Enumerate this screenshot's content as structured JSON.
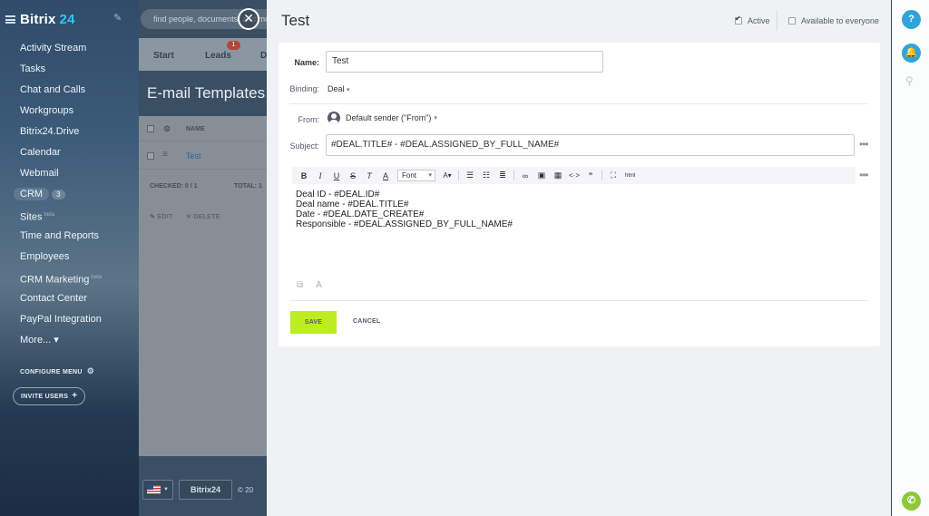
{
  "app": {
    "logo_name": "Bitrix",
    "logo_num": "24",
    "colors": {
      "accent": "#2fc6f6",
      "save": "#bbed21",
      "phone": "#8fc93a"
    }
  },
  "sidebar": {
    "items": [
      {
        "label": "Activity Stream"
      },
      {
        "label": "Tasks"
      },
      {
        "label": "Chat and Calls"
      },
      {
        "label": "Workgroups"
      },
      {
        "label": "Bitrix24.Drive"
      },
      {
        "label": "Calendar"
      },
      {
        "label": "Webmail"
      },
      {
        "label": "CRM",
        "count": "3"
      },
      {
        "label": "Sites",
        "sup": "beta"
      },
      {
        "label": "Time and Reports"
      },
      {
        "label": "Employees"
      },
      {
        "label": "CRM Marketing",
        "sup": "beta"
      },
      {
        "label": "Contact Center"
      },
      {
        "label": "PayPal Integration"
      },
      {
        "label": "More... ▾"
      }
    ],
    "configure_label": "CONFIGURE MENU",
    "invite_label": "INVITE USERS"
  },
  "background": {
    "search_placeholder": "find people, documents, and mo",
    "tabs": [
      "Start",
      "Leads",
      "D"
    ],
    "leads_badge": "1",
    "page_title": "E-mail Templates",
    "grid": {
      "header_name": "NAME",
      "row_name": "Test",
      "checked": "CHECKED: 0 / 1",
      "total": "TOTAL: 1",
      "edit": "EDIT",
      "delete": "DELETE"
    },
    "footer_b24": "Bitrix24",
    "footer_copy": "© 20"
  },
  "slider": {
    "title": "Test",
    "active_label": "Active",
    "active_checked": true,
    "everyone_label": "Available to everyone",
    "everyone_checked": false,
    "form": {
      "name_label": "Name:",
      "name_value": "Test",
      "binding_label": "Binding:",
      "binding_value": "Deal",
      "from_label": "From:",
      "from_value": "Default sender (\"From\")",
      "subject_label": "Subject:",
      "subject_value": "#DEAL.TITLE# -  #DEAL.ASSIGNED_BY_FULL_NAME#"
    },
    "toolbar": {
      "bold": "B",
      "italic": "I",
      "underline": "U",
      "strike": "S",
      "clear": "T",
      "font_color": "A",
      "font": "Font",
      "font_size": "A",
      "html": "html"
    },
    "editor_lines": [
      "Deal ID - #DEAL.ID#",
      "Deal name - #DEAL.TITLE#",
      "Date - #DEAL.DATE_CREATE#",
      "Responsible - #DEAL.ASSIGNED_BY_FULL_NAME#"
    ],
    "save_label": "SAVE",
    "cancel_label": "CANCEL"
  },
  "rightbar": {
    "help": "?",
    "phone": "✆"
  }
}
